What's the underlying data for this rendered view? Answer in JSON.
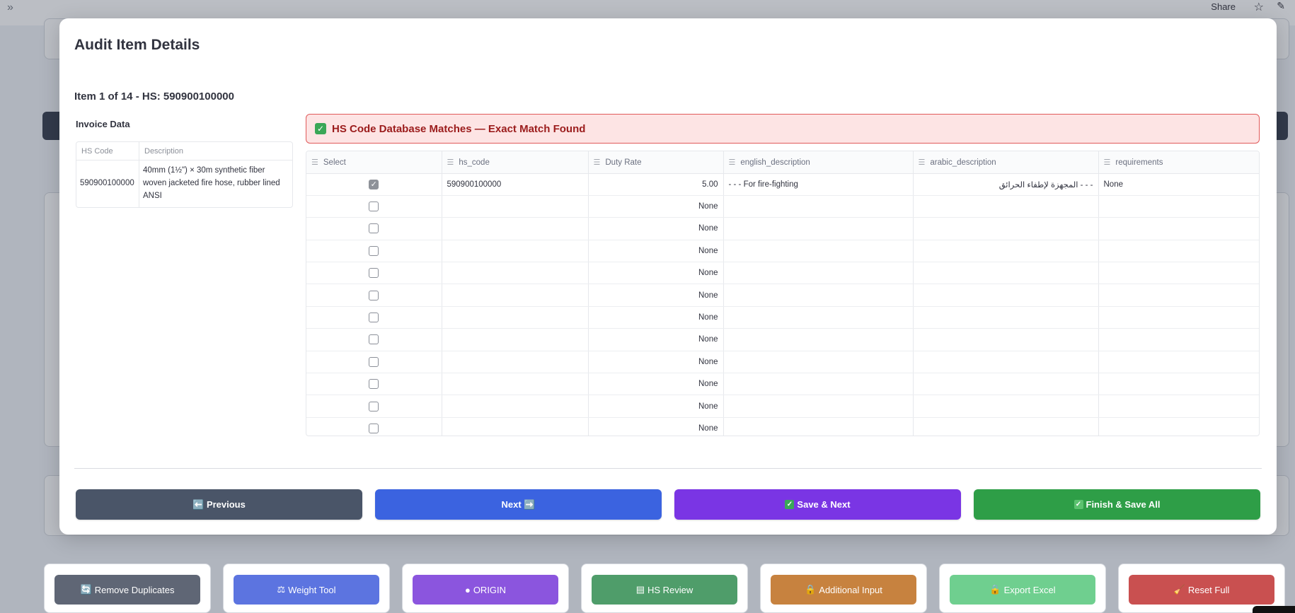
{
  "topbar": {
    "expand_icon": "double-chevron-right-icon",
    "share_label": "Share"
  },
  "modal": {
    "title": "Audit Item Details",
    "item_line": "Item 1 of 14 - HS: 590900100000",
    "invoice": {
      "heading": "Invoice Data",
      "columns": [
        "HS Code",
        "Description"
      ],
      "row": {
        "hs_code": "590900100000",
        "description": "40mm (1½\") × 30m synthetic fiber woven jacketed fire hose, rubber lined ANSI"
      }
    },
    "banner": {
      "icon": "check-box-icon",
      "text": "HS Code Database Matches — Exact Match Found"
    },
    "grid": {
      "columns": [
        "Select",
        "hs_code",
        "Duty Rate",
        "english_description",
        "arabic_description",
        "requirements"
      ],
      "rows": [
        {
          "selected": true,
          "hs_code": "590900100000",
          "duty_rate": "5.00",
          "english_description": "- - - For fire-fighting",
          "arabic_description": "- - - المجهزة لإطفاء الحرائق",
          "requirements": "None"
        },
        {
          "selected": false,
          "hs_code": "",
          "duty_rate": "None",
          "english_description": "",
          "arabic_description": "",
          "requirements": ""
        },
        {
          "selected": false,
          "hs_code": "",
          "duty_rate": "None",
          "english_description": "",
          "arabic_description": "",
          "requirements": ""
        },
        {
          "selected": false,
          "hs_code": "",
          "duty_rate": "None",
          "english_description": "",
          "arabic_description": "",
          "requirements": ""
        },
        {
          "selected": false,
          "hs_code": "",
          "duty_rate": "None",
          "english_description": "",
          "arabic_description": "",
          "requirements": ""
        },
        {
          "selected": false,
          "hs_code": "",
          "duty_rate": "None",
          "english_description": "",
          "arabic_description": "",
          "requirements": ""
        },
        {
          "selected": false,
          "hs_code": "",
          "duty_rate": "None",
          "english_description": "",
          "arabic_description": "",
          "requirements": ""
        },
        {
          "selected": false,
          "hs_code": "",
          "duty_rate": "None",
          "english_description": "",
          "arabic_description": "",
          "requirements": ""
        },
        {
          "selected": false,
          "hs_code": "",
          "duty_rate": "None",
          "english_description": "",
          "arabic_description": "",
          "requirements": ""
        },
        {
          "selected": false,
          "hs_code": "",
          "duty_rate": "None",
          "english_description": "",
          "arabic_description": "",
          "requirements": ""
        },
        {
          "selected": false,
          "hs_code": "",
          "duty_rate": "None",
          "english_description": "",
          "arabic_description": "",
          "requirements": ""
        },
        {
          "selected": false,
          "hs_code": "",
          "duty_rate": "None",
          "english_description": "",
          "arabic_description": "",
          "requirements": ""
        }
      ]
    },
    "actions": {
      "previous": "⬅️ Previous",
      "next": "Next ➡️",
      "save_next": "Save & Next",
      "finish": "Finish & Save All"
    }
  },
  "tools": [
    {
      "label": "Remove Duplicates",
      "icon": "refresh-icon",
      "color": "#5f6675"
    },
    {
      "label": "Weight Tool",
      "icon": "scale-icon",
      "color": "#5c74e0"
    },
    {
      "label": "ORIGIN",
      "icon": "globe-icon",
      "color": "#8b55de"
    },
    {
      "label": "HS Review",
      "icon": "document-icon",
      "color": "#4f9d6a"
    },
    {
      "label": "Additional Input",
      "icon": "lock-icon",
      "color": "#c7823f"
    },
    {
      "label": "Export Excel",
      "icon": "lock-icon",
      "color": "#6fcf8f"
    },
    {
      "label": "Reset Full",
      "icon": "broom-icon",
      "color": "#c95050"
    }
  ],
  "colors": {
    "previous": "#4a5568",
    "next": "#3b63e0",
    "save_next": "#7a35e4",
    "finish": "#2e9e47",
    "banner_bg": "#fde4e4",
    "banner_border": "#e05a5a",
    "banner_text": "#9b1c1c"
  }
}
